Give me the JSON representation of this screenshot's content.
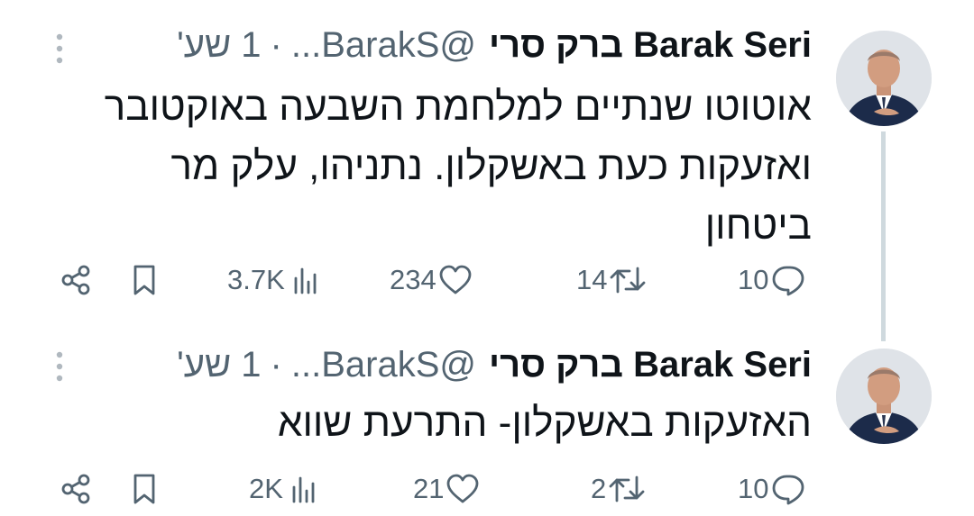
{
  "tweets": [
    {
      "author_name": "Barak Seri ברק סרי",
      "handle": "@BarakS...",
      "separator": "·",
      "time": "1 שע'",
      "text_lines": [
        "אוטוטו שנתיים למלחמת השבעה באוקטובר",
        "ואזעקות כעת באשקלון. נתניהו, עלק מר",
        "ביטחון"
      ],
      "replies": "10",
      "reposts": "14",
      "likes": "234",
      "views": "3.7K"
    },
    {
      "author_name": "Barak Seri ברק סרי",
      "handle": "@BarakS...",
      "separator": "·",
      "time": "1 שע'",
      "text_lines": [
        "האזעקות באשקלון- התרעת שווא"
      ],
      "replies": "10",
      "reposts": "2",
      "likes": "21",
      "views": "2K"
    }
  ],
  "colors": {
    "text": "#0f1419",
    "secondary": "#536471",
    "thread_line": "#cfd9de",
    "avatar_suit": "#1c2b4a"
  },
  "icons": [
    "more-vertical-icon",
    "reply-icon",
    "repost-icon",
    "like-icon",
    "views-icon",
    "bookmark-icon",
    "share-icon"
  ]
}
